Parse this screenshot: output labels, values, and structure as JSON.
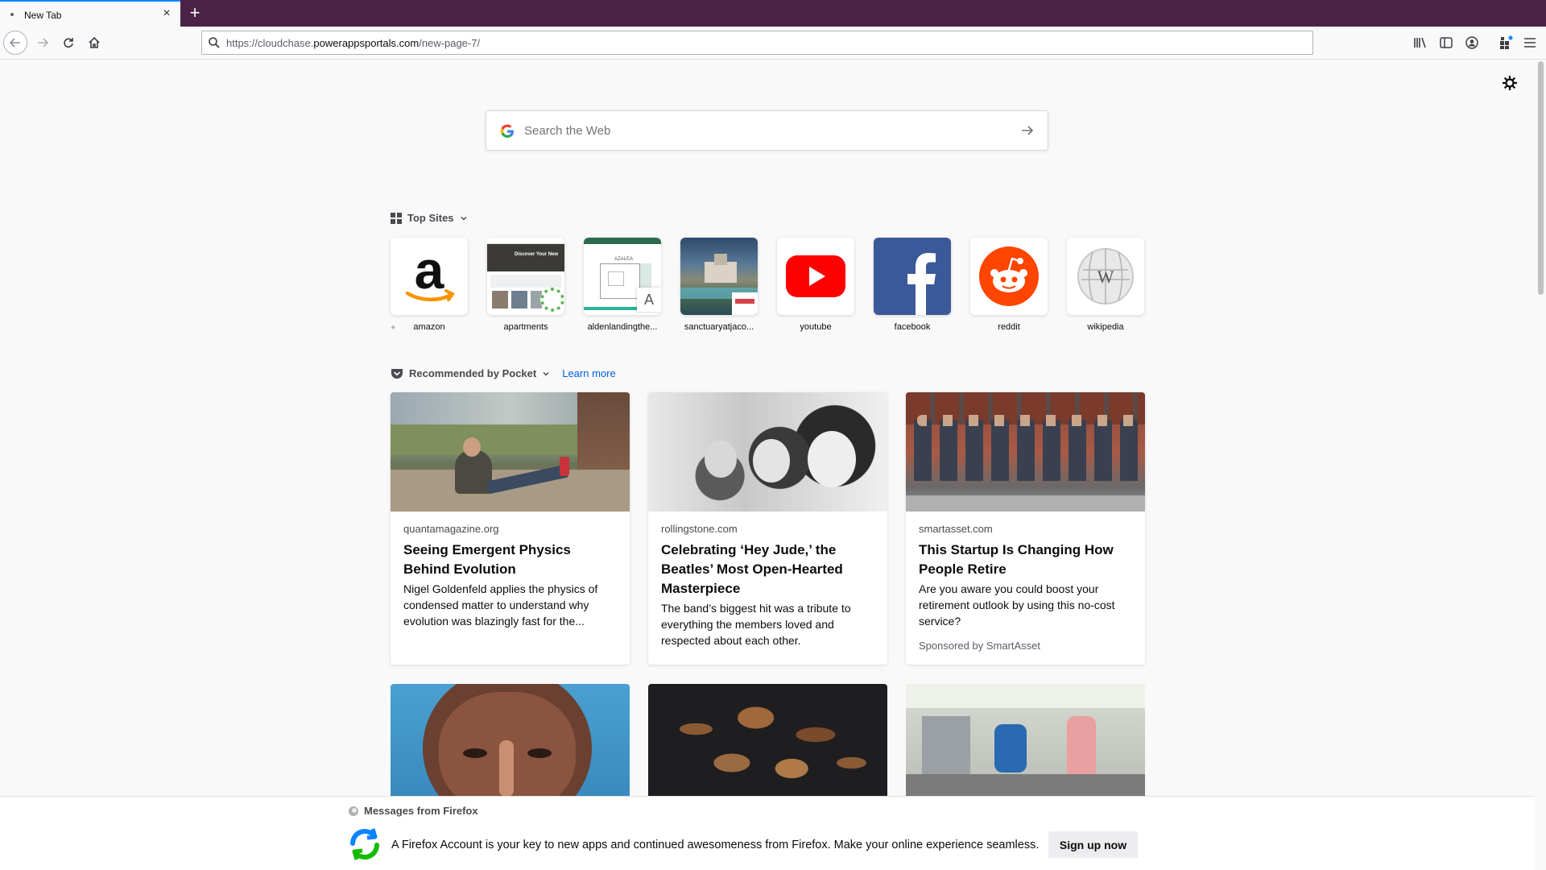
{
  "tab": {
    "title": "New Tab",
    "close": "×",
    "new_tab": "+"
  },
  "urlbar": {
    "scheme": "https://cloudchase.",
    "domain": "powerappsportals.com",
    "path": "/new-page-7/"
  },
  "search": {
    "placeholder": "Search the Web"
  },
  "top_sites": {
    "heading": "Top Sites",
    "sites": [
      {
        "label": "amazon",
        "icon": "amazon-icon"
      },
      {
        "label": "apartments",
        "icon": "screenshot",
        "thumb_text": "Discover Your New"
      },
      {
        "label": "aldenlandingthe...",
        "icon": "screenshot",
        "thumb_text": "AZALEA",
        "badge": "A"
      },
      {
        "label": "sanctuaryatjaco...",
        "icon": "screenshot"
      },
      {
        "label": "youtube",
        "icon": "youtube-icon"
      },
      {
        "label": "facebook",
        "icon": "facebook-icon"
      },
      {
        "label": "reddit",
        "icon": "reddit-icon"
      },
      {
        "label": "wikipedia",
        "icon": "wikipedia-icon"
      }
    ]
  },
  "pocket": {
    "heading": "Recommended by Pocket",
    "learn_more": "Learn more",
    "cards": [
      {
        "source": "quantamagazine.org",
        "title": "Seeing Emergent Physics Behind Evolution",
        "desc": "Nigel Goldenfeld applies the physics of condensed matter to understand why evolution was blazingly fast for the...",
        "sponsor": ""
      },
      {
        "source": "rollingstone.com",
        "title": "Celebrating ‘Hey Jude,’ the Beatles’ Most Open-Hearted Masterpiece",
        "desc": "The band’s biggest hit was a tribute to everything the members loved and respected about each other.",
        "sponsor": ""
      },
      {
        "source": "smartasset.com",
        "title": "This Startup Is Changing How People Retire",
        "desc": "Are you aware you could boost your retirement outlook by using this no-cost service?",
        "sponsor": "Sponsored by SmartAsset"
      }
    ]
  },
  "messages": {
    "heading": "Messages from Firefox",
    "text": "A Firefox Account is your key to new apps and continued awesomeness from Firefox. Make your online experience seamless.",
    "button": "Sign up now"
  },
  "colors": {
    "tab_strip": "#4a2346",
    "accent": "#0a84ff",
    "link": "#0060df"
  }
}
